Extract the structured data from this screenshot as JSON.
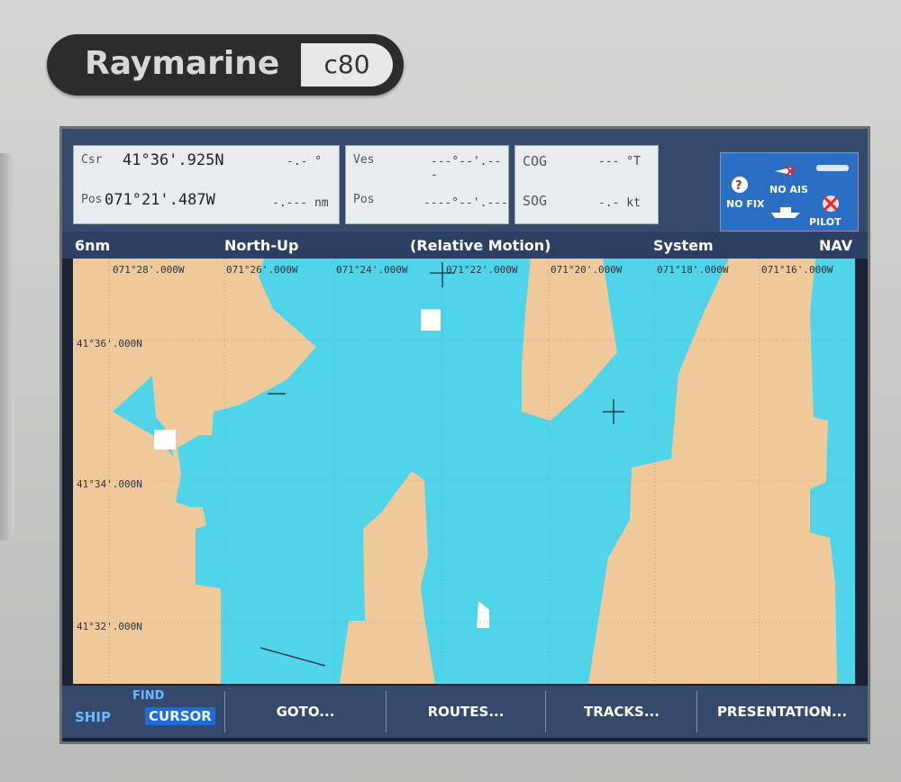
{
  "device": {
    "brand": "Raymarine",
    "model": "c80"
  },
  "databar": {
    "cursor": {
      "label": "Csr",
      "lat": "41°36'.925N",
      "bearing": "-.- °"
    },
    "position": {
      "label": "Pos",
      "lon": "071°21'.487W",
      "range": "-.--- nm"
    },
    "vessel": {
      "label": "Ves",
      "value": "---°--'.---"
    },
    "vessel_pos": {
      "label": "Pos",
      "value": "----°--'.---"
    },
    "cog": {
      "label": "COG",
      "value": "--- °T"
    },
    "sog": {
      "label": "SOG",
      "value": "-.- kt"
    },
    "status": {
      "fix": "NO FIX",
      "ais": "NO AIS",
      "pilot": "PILOT"
    }
  },
  "chart_header": {
    "range": "6nm",
    "orientation": "North-Up",
    "motion": "(Relative Motion)",
    "mode": "System",
    "page": "NAV"
  },
  "grid_labels": {
    "longitudes": [
      "071°28'.000W",
      "071°26'.000W",
      "071°24'.000W",
      "071°22'.000W",
      "071°20'.000W",
      "071°18'.000W",
      "071°16'.000W"
    ],
    "latitudes": [
      "41°36'.000N",
      "41°34'.000N",
      "41°32'.000N"
    ]
  },
  "colors": {
    "water": "#4fd4ea",
    "land": "#f0c99a",
    "panel": "#34496b"
  },
  "softkeys": {
    "find_top": "FIND",
    "ship": "SHIP",
    "cursor": "CURSOR",
    "goto": "GOTO...",
    "routes": "ROUTES...",
    "tracks": "TRACKS...",
    "presentation": "PRESENTATION..."
  }
}
